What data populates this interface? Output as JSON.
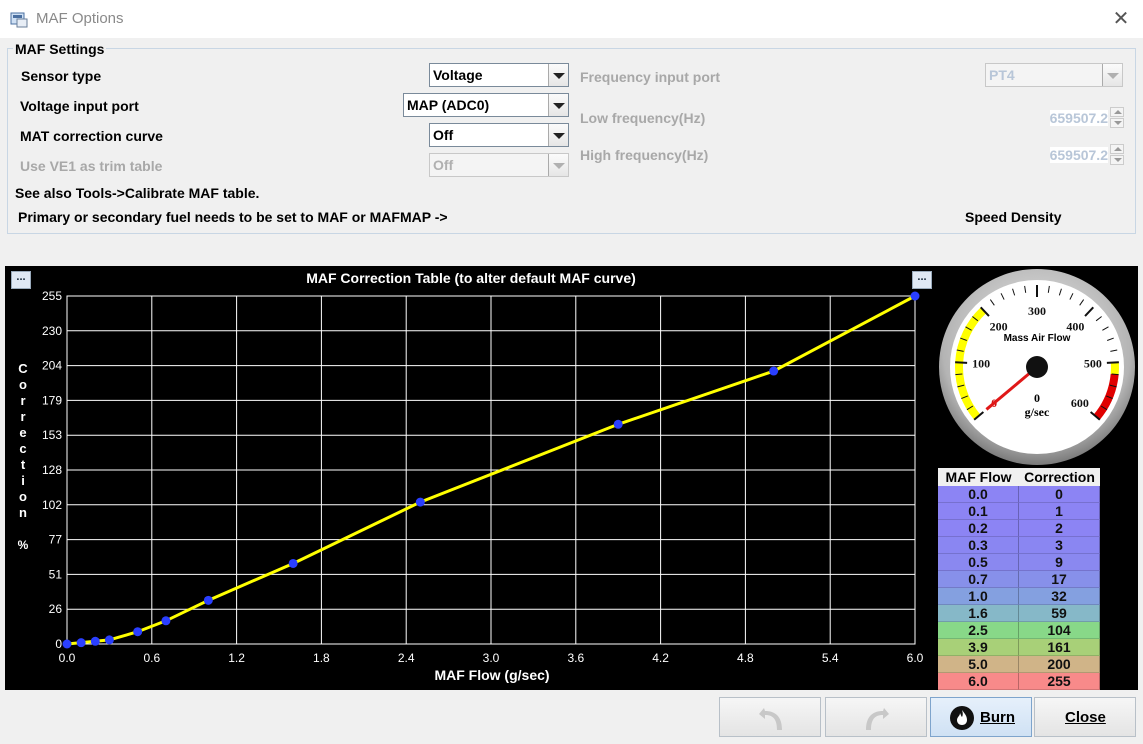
{
  "window": {
    "title": "MAF Options",
    "close_glyph": "✕"
  },
  "settings": {
    "legend": "MAF Settings",
    "sensor_type": {
      "label": "Sensor type",
      "value": "Voltage"
    },
    "voltage_input_port": {
      "label": "Voltage input port",
      "value": "MAP (ADC0)"
    },
    "mat_correction": {
      "label": "MAT correction curve",
      "value": "Off"
    },
    "use_ve1": {
      "label": "Use VE1 as trim table",
      "value": "Off"
    },
    "frequency_input_port": {
      "label": "Frequency input port",
      "value": "PT4"
    },
    "low_frequency": {
      "label": "Low frequency(Hz)",
      "value": "659507.2"
    },
    "high_frequency": {
      "label": "High frequency(Hz)",
      "value": "659507.2"
    },
    "note1": "See also Tools->Calibrate MAF table.",
    "note2": "Primary or secondary fuel needs to be set to MAF or MAFMAP ->",
    "fuel_mode": "Speed Density"
  },
  "chart_buttons": {
    "left": "...",
    "right": "..."
  },
  "chart_data": {
    "type": "line",
    "title": "MAF Correction Table (to alter default MAF curve)",
    "xlabel": "MAF Flow (g/sec)",
    "ylabel": "Correction %",
    "x_ticks": [
      "0.0",
      "0.6",
      "1.2",
      "1.8",
      "2.4",
      "3.0",
      "3.6",
      "4.2",
      "4.8",
      "5.4",
      "6.0"
    ],
    "y_ticks": [
      "0",
      "26",
      "51",
      "77",
      "102",
      "128",
      "153",
      "179",
      "204",
      "230",
      "255"
    ],
    "xlim": [
      0,
      6
    ],
    "ylim": [
      0,
      255
    ],
    "grid": true,
    "series": [
      {
        "x": [
          0.0,
          0.1,
          0.2,
          0.3,
          0.5,
          0.7,
          1.0,
          1.6,
          2.5,
          3.9,
          5.0,
          6.0
        ],
        "y": [
          0,
          1,
          2,
          3,
          9,
          17,
          32,
          59,
          104,
          161,
          200,
          255
        ]
      }
    ],
    "line_color": "#ffff00",
    "point_color": "#2a3fff",
    "background": "#000000",
    "grid_color": "#ffffff"
  },
  "gauge": {
    "title": "Mass Air Flow",
    "unit": "g/sec",
    "value": "0",
    "ticks": [
      "0",
      "100",
      "200",
      "300",
      "400",
      "500",
      "600"
    ],
    "min": 0,
    "max": 600,
    "current": 0,
    "warn_low_color": "#ffff00",
    "danger_color": "#e00000"
  },
  "table": {
    "headers": [
      "MAF Flow",
      "Correction"
    ],
    "rows": [
      {
        "flow": "0.0",
        "corr": "0",
        "color": "#8c84f4"
      },
      {
        "flow": "0.1",
        "corr": "1",
        "color": "#8c84f4"
      },
      {
        "flow": "0.2",
        "corr": "2",
        "color": "#8c84f4"
      },
      {
        "flow": "0.3",
        "corr": "3",
        "color": "#8a86f2"
      },
      {
        "flow": "0.5",
        "corr": "9",
        "color": "#8a88f0"
      },
      {
        "flow": "0.7",
        "corr": "17",
        "color": "#8790ea"
      },
      {
        "flow": "1.0",
        "corr": "32",
        "color": "#84a0e0"
      },
      {
        "flow": "1.6",
        "corr": "59",
        "color": "#86b8c8"
      },
      {
        "flow": "2.5",
        "corr": "104",
        "color": "#88d888"
      },
      {
        "flow": "3.9",
        "corr": "161",
        "color": "#a8d078"
      },
      {
        "flow": "5.0",
        "corr": "200",
        "color": "#d0b488"
      },
      {
        "flow": "6.0",
        "corr": "255",
        "color": "#f88a8a"
      }
    ]
  },
  "buttons": {
    "burn": "Burn",
    "close": "Close"
  }
}
